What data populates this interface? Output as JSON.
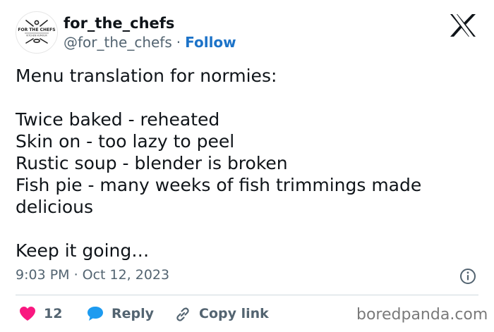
{
  "author": {
    "display_name": "for_the_chefs",
    "handle": "@for_the_chefs",
    "separator": "·",
    "follow_label": "Follow",
    "avatar_text": "FOR THE CHEFS",
    "avatar_subtext": "KITCHEN HUMOUR"
  },
  "tweet": {
    "lines": [
      "Menu translation for normies:",
      "",
      "Twice baked - reheated",
      "Skin on - too lazy to peel",
      "Rustic soup - blender is broken",
      "Fish pie - many weeks of fish trimmings made",
      "delicious",
      "",
      "Keep it going…"
    ]
  },
  "meta": {
    "time": "9:03 PM",
    "separator": "·",
    "date": "Oct 12, 2023"
  },
  "actions": {
    "like_count": "12",
    "reply_label": "Reply",
    "copy_label": "Copy link"
  },
  "watermark": "boredpanda.com",
  "colors": {
    "like": "#f91880",
    "reply": "#1d9bf0",
    "follow": "#1d73c8",
    "muted": "#536471",
    "text": "#0f1419",
    "divider": "#cfd9de"
  },
  "icons": {
    "platform": "x-logo-icon",
    "like": "heart-icon",
    "reply": "speech-bubble-icon",
    "copy": "link-icon",
    "info": "info-icon"
  }
}
